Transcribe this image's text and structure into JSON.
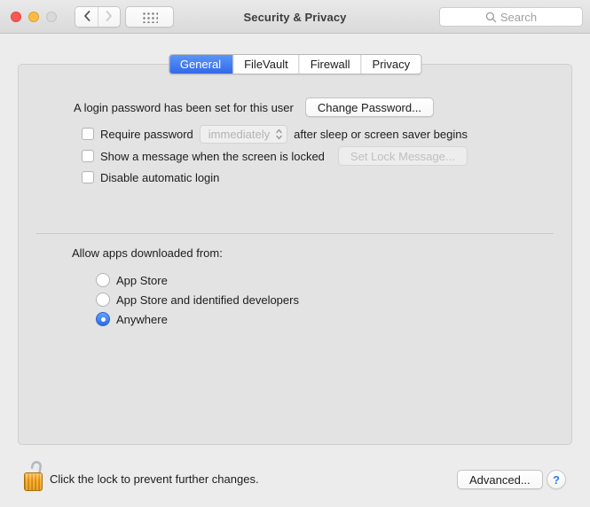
{
  "window": {
    "title": "Security & Privacy",
    "search_placeholder": "Search"
  },
  "tabs": [
    {
      "label": "General",
      "selected": true
    },
    {
      "label": "FileVault",
      "selected": false
    },
    {
      "label": "Firewall",
      "selected": false
    },
    {
      "label": "Privacy",
      "selected": false
    }
  ],
  "general": {
    "password_status": "A login password has been set for this user",
    "change_password_label": "Change Password...",
    "require_password": {
      "checked": false,
      "label": "Require password",
      "dropdown_value": "immediately",
      "suffix": "after sleep or screen saver begins"
    },
    "show_message": {
      "checked": false,
      "label": "Show a message when the screen is locked",
      "button_label": "Set Lock Message...",
      "button_disabled": true
    },
    "disable_auto_login": {
      "checked": false,
      "label": "Disable automatic login"
    },
    "allow_heading": "Allow apps downloaded from:",
    "allow_options": [
      {
        "label": "App Store",
        "selected": false
      },
      {
        "label": "App Store and identified developers",
        "selected": false
      },
      {
        "label": "Anywhere",
        "selected": true
      }
    ]
  },
  "footer": {
    "lock_text": "Click the lock to prevent further changes.",
    "lock_state": "unlocked",
    "advanced_label": "Advanced...",
    "help_label": "?"
  },
  "icons": {
    "back": "chevron-left-icon",
    "forward": "chevron-right-icon",
    "show_all": "grid-icon",
    "search": "magnifier-icon",
    "dropdown": "up-down-chevrons-icon",
    "lock": "open-padlock-icon",
    "help": "question-mark-icon"
  },
  "colors": {
    "window_bg": "#ececec",
    "panel_bg": "#e3e3e3",
    "tab_selected_blue": "#3c78f2",
    "radio_selected_blue": "#3c80f4",
    "help_blue": "#2d7ff2",
    "lock_orange": "#f0a21c",
    "traffic_red": "#fc5753",
    "traffic_yellow": "#fdbc40",
    "traffic_gray": "#d9d9d9"
  }
}
